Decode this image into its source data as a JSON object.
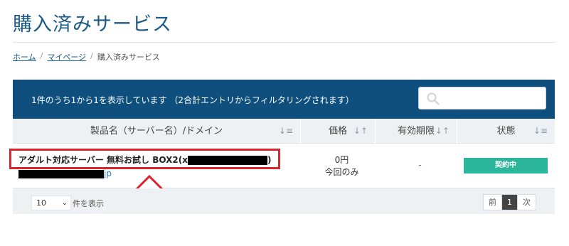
{
  "page": {
    "title": "購入済みサービス"
  },
  "breadcrumb": {
    "home": "ホーム",
    "mypage": "マイページ",
    "current": "購入済みサービス",
    "sep": "/"
  },
  "table": {
    "info": "1件のうち1から1を表示しています （2合計エントリからフィルタリングされます）",
    "search": {
      "placeholder": ""
    },
    "columns": [
      "製品名（サーバー名）/ドメイン",
      "価格",
      "有効期限",
      "状態"
    ],
    "rows": [
      {
        "product_prefix": "アダルト対応サーバー 無料お試し BOX2(x",
        "product_suffix": ")",
        "domain_suffix": "jp",
        "price": "0円",
        "billing": "今回のみ",
        "expiry": "-",
        "status": "契約中"
      }
    ],
    "length": {
      "value": "10",
      "label": "件を表示"
    },
    "pager": {
      "prev": "前",
      "page": "1",
      "next": "次"
    }
  },
  "colors": {
    "header": "#0e4f7e",
    "title": "#1c5a86",
    "status": "#2bb59b",
    "annotation": "#d9252b"
  }
}
